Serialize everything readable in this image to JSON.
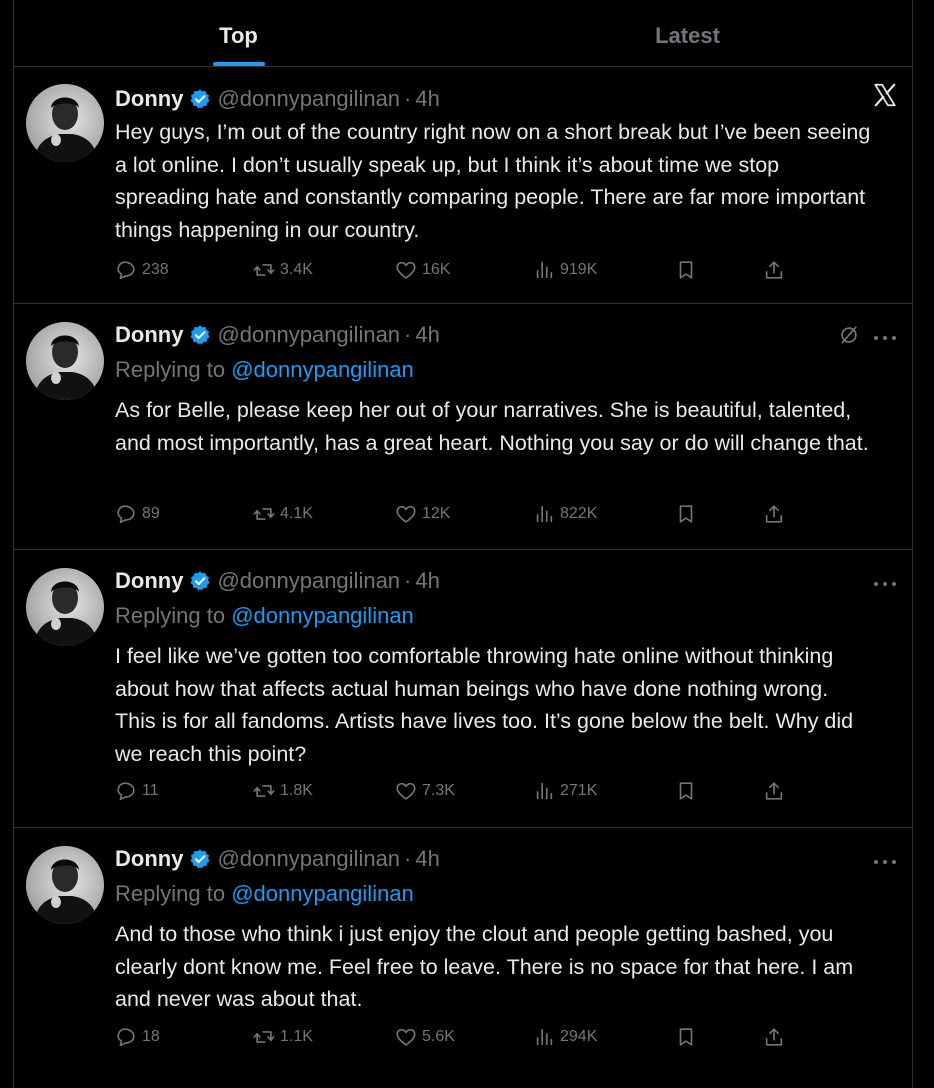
{
  "tabs": [
    {
      "label": "Top"
    },
    {
      "label": "Latest"
    }
  ],
  "tweets": [
    {
      "name": "Donny",
      "handle": "@donnypangilinan",
      "dot": "·",
      "time": "4h",
      "reply_label": "",
      "reply_handle": "",
      "text": "Hey guys, I’m out of the country right now on a short break but I’ve been seeing a lot online. I don’t usually speak up, but I think it’s about time we stop spreading hate and constantly comparing people. There are far more important things happening in our country.",
      "replies": "238",
      "retweets": "3.4K",
      "likes": "16K",
      "views": "919K"
    },
    {
      "name": "Donny",
      "handle": "@donnypangilinan",
      "dot": "·",
      "time": "4h",
      "reply_label": "Replying to",
      "reply_handle": "@donnypangilinan",
      "text": "As for Belle, please keep her out of your narratives. She is beautiful, talented, and most importantly, has a great heart. Nothing you say or do will change that.",
      "replies": "89",
      "retweets": "4.1K",
      "likes": "12K",
      "views": "822K"
    },
    {
      "name": "Donny",
      "handle": "@donnypangilinan",
      "dot": "·",
      "time": "4h",
      "reply_label": "Replying to",
      "reply_handle": "@donnypangilinan",
      "text": "I feel like we’ve gotten too comfortable throwing hate online without thinking about how that affects actual human beings who have done nothing wrong. This is for all fandoms. Artists have lives too. It’s gone below the belt. Why did we reach this point?",
      "replies": "11",
      "retweets": "1.8K",
      "likes": "7.3K",
      "views": "271K"
    },
    {
      "name": "Donny",
      "handle": "@donnypangilinan",
      "dot": "·",
      "time": "4h",
      "reply_label": "Replying to",
      "reply_handle": "@donnypangilinan",
      "text": "And to those who think i just enjoy the clout and people getting bashed, you clearly dont know me. Feel free to leave. There is no space for that here. I am and never was about that.",
      "replies": "18",
      "retweets": "1.1K",
      "likes": "5.6K",
      "views": "294K"
    }
  ],
  "icons": {
    "reply": "speech-bubble",
    "retweet": "retweet-arrows",
    "like": "heart",
    "views": "bar-chart",
    "bookmark": "bookmark",
    "share": "share-upload",
    "more": "more-dots",
    "verified": "verified-badge",
    "x_logo": "x-logo",
    "grok": "grok-slash-circle"
  },
  "colors": {
    "background": "#000000",
    "text": "#e7e9ea",
    "muted": "#71767b",
    "accent": "#1d9bf0",
    "divider": "#2f3336"
  }
}
